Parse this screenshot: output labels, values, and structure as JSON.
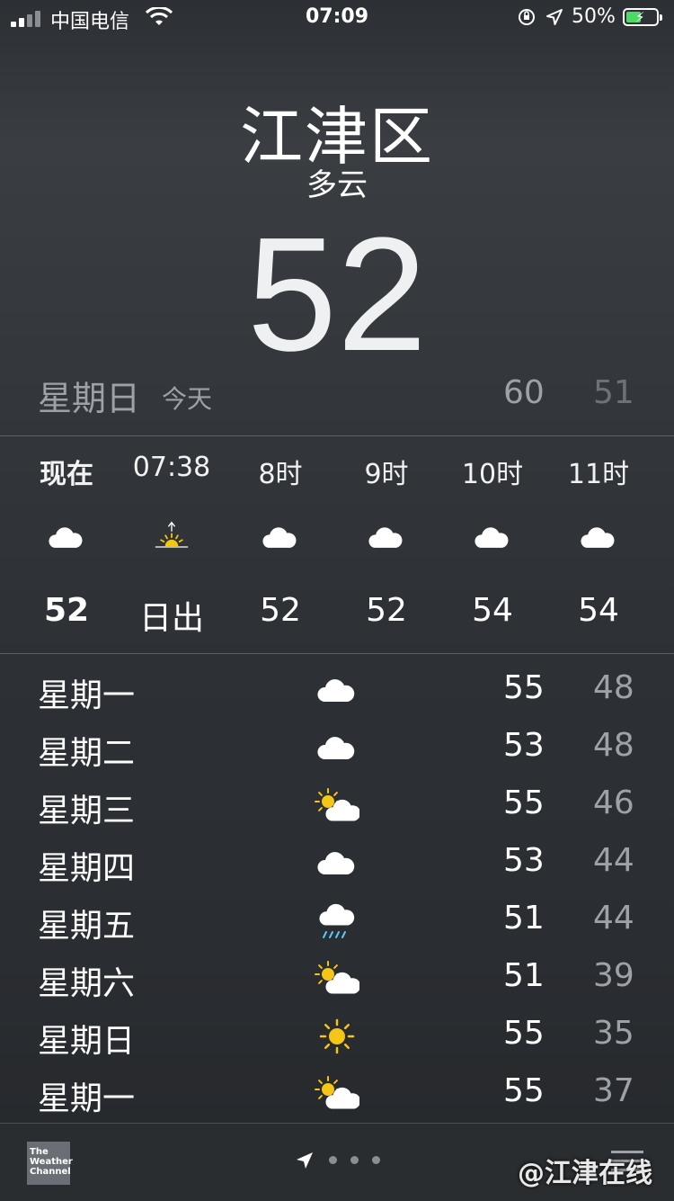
{
  "status_bar": {
    "carrier": "中国电信",
    "time": "07:09",
    "battery_percent": "50%",
    "battery_level": 0.5,
    "battery_color": "#4cd964"
  },
  "location": {
    "city": "江津区",
    "condition": "多云",
    "current_temp": "52"
  },
  "today": {
    "day": "星期日",
    "label": "今天",
    "high": "60",
    "low": "51"
  },
  "hourly": [
    {
      "label": "现在",
      "icon": "cloud-icon",
      "value": "52",
      "bold": true
    },
    {
      "label": "07:38",
      "icon": "sunrise-icon",
      "value": "日出",
      "bold": false
    },
    {
      "label": "8时",
      "icon": "cloud-icon",
      "value": "52",
      "bold": false
    },
    {
      "label": "9时",
      "icon": "cloud-icon",
      "value": "52",
      "bold": false
    },
    {
      "label": "10时",
      "icon": "cloud-icon",
      "value": "54",
      "bold": false
    },
    {
      "label": "11时",
      "icon": "cloud-icon",
      "value": "54",
      "bold": false
    }
  ],
  "daily": [
    {
      "day": "星期一",
      "icon": "cloud-icon",
      "high": "55",
      "low": "48"
    },
    {
      "day": "星期二",
      "icon": "cloud-icon",
      "high": "53",
      "low": "48"
    },
    {
      "day": "星期三",
      "icon": "partly-sunny-icon",
      "high": "55",
      "low": "46"
    },
    {
      "day": "星期四",
      "icon": "cloud-icon",
      "high": "53",
      "low": "44"
    },
    {
      "day": "星期五",
      "icon": "rain-icon",
      "high": "51",
      "low": "44"
    },
    {
      "day": "星期六",
      "icon": "partly-sunny-icon",
      "high": "51",
      "low": "39"
    },
    {
      "day": "星期日",
      "icon": "sun-icon",
      "high": "55",
      "low": "35"
    },
    {
      "day": "星期一",
      "icon": "partly-sunny-icon",
      "high": "55",
      "low": "37"
    }
  ],
  "footer": {
    "logo_text": "The Weather Channel",
    "page_count": 4,
    "watermark": "@江津在线"
  },
  "colors": {
    "sun": "#f5c518",
    "rain": "#5ac8fa",
    "cloud": "#ffffff"
  }
}
